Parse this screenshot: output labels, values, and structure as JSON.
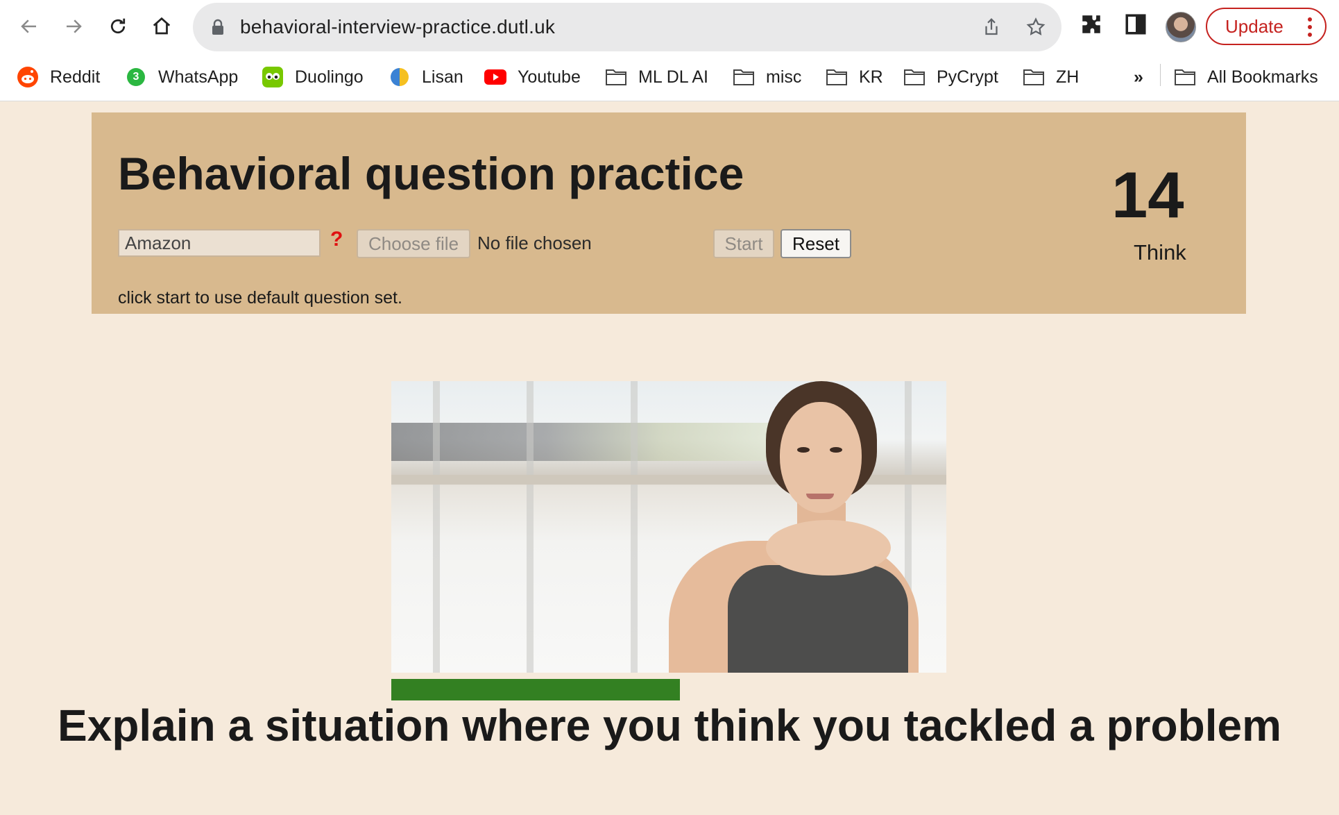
{
  "browser": {
    "url": "behavioral-interview-practice.dutl.uk",
    "update_label": "Update",
    "bookmarks": [
      {
        "label": "Reddit",
        "icon": "reddit-icon"
      },
      {
        "label": "WhatsApp",
        "icon": "whatsapp-icon"
      },
      {
        "label": "Duolingo",
        "icon": "duolingo-icon"
      },
      {
        "label": "Lisan",
        "icon": "lisan-icon"
      },
      {
        "label": "Youtube",
        "icon": "youtube-icon"
      },
      {
        "label": "ML DL AI",
        "icon": "folder-icon"
      },
      {
        "label": "misc",
        "icon": "folder-icon"
      },
      {
        "label": "KR",
        "icon": "folder-icon"
      },
      {
        "label": "PyCrypt",
        "icon": "folder-icon"
      },
      {
        "label": "ZH",
        "icon": "folder-icon"
      }
    ],
    "overflow_label": "»",
    "all_bookmarks_label": "All Bookmarks",
    "whatsapp_badge": "3"
  },
  "page": {
    "title": "Behavioral question practice",
    "company_input": {
      "value": "Amazon"
    },
    "help_label": "?",
    "file_button_label": "Choose file",
    "file_status": "No file chosen",
    "start_label": "Start",
    "reset_label": "Reset",
    "hint": "click start to use default question set.",
    "timer": "14",
    "phase": "Think",
    "progress": 0.52,
    "question": "Explain a situation where you think you tackled a problem"
  },
  "colors": {
    "page_background": "#f6eadb",
    "header_background": "#d8b98e",
    "progress_fill": "#338022",
    "update_accent": "#c5221f"
  }
}
